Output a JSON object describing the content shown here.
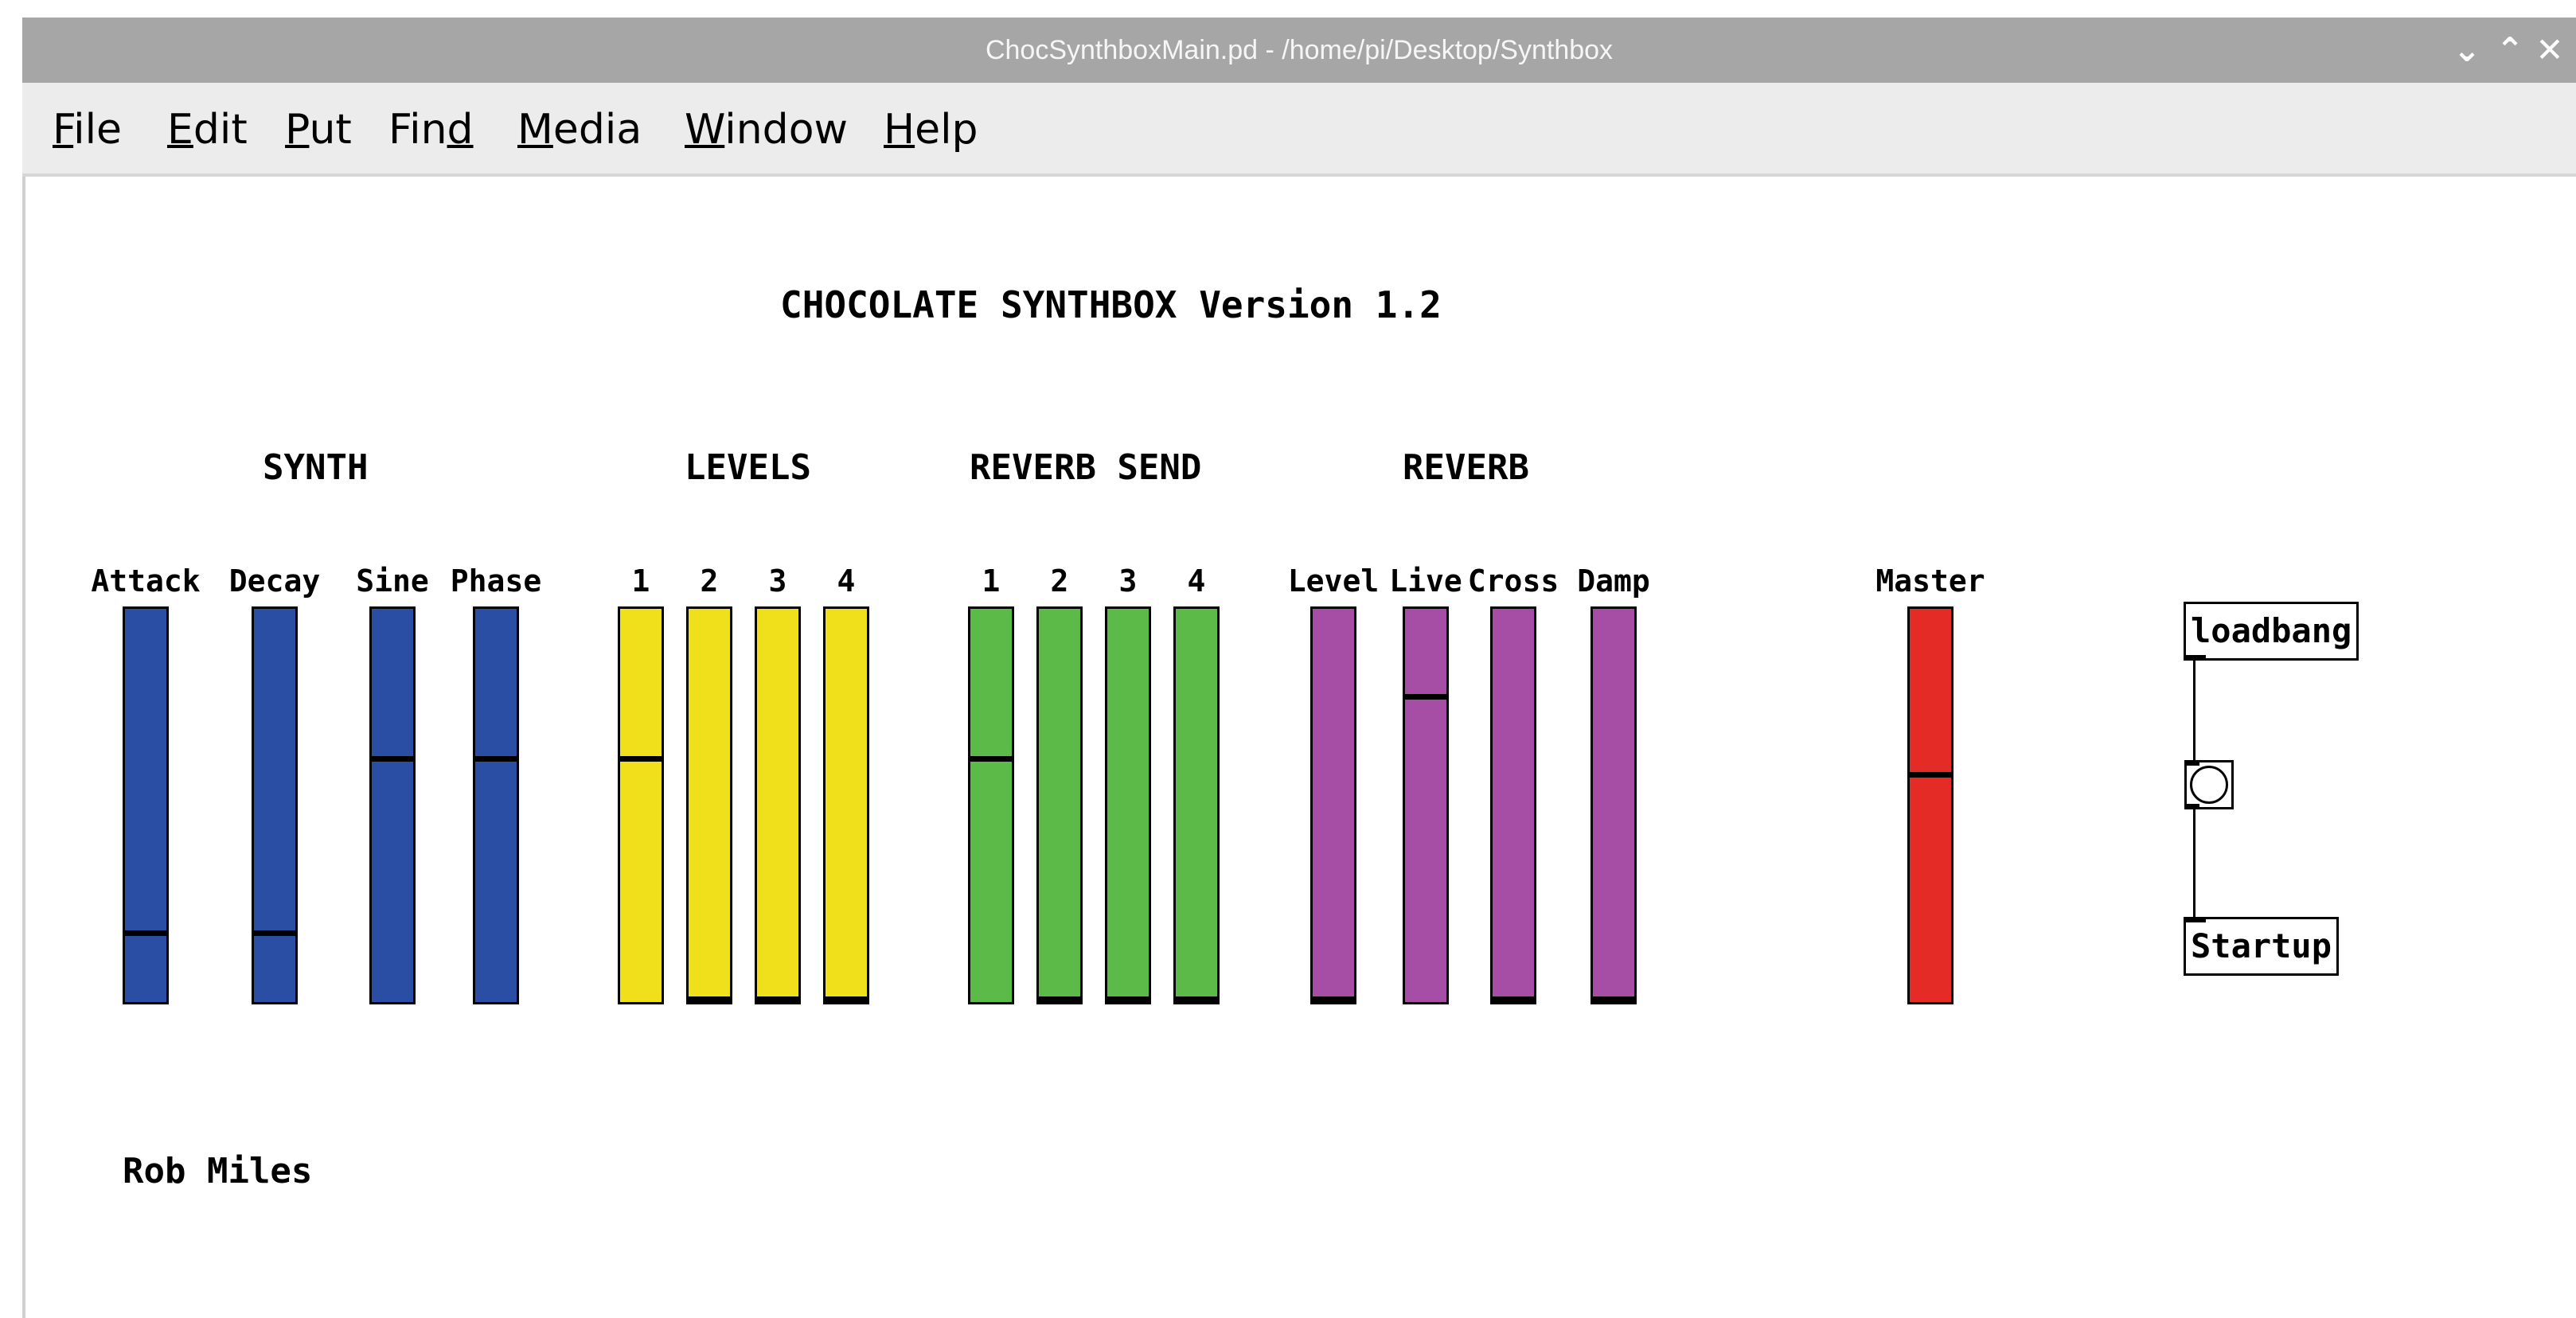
{
  "window": {
    "title": "ChocSynthboxMain.pd  - /home/pi/Desktop/Synthbox",
    "controls": {
      "minimize": "⌄",
      "maximize": "⌃",
      "close": "✕"
    }
  },
  "menu": [
    {
      "pre": "",
      "ul": "F",
      "post": "ile"
    },
    {
      "pre": "",
      "ul": "E",
      "post": "dit"
    },
    {
      "pre": "",
      "ul": "P",
      "post": "ut"
    },
    {
      "pre": "Fin",
      "ul": "d",
      "post": ""
    },
    {
      "pre": "",
      "ul": "M",
      "post": "edia"
    },
    {
      "pre": "",
      "ul": "W",
      "post": "indow"
    },
    {
      "pre": "",
      "ul": "H",
      "post": "elp"
    }
  ],
  "patch": {
    "title": "CHOCOLATE SYNTHBOX Version 1.2",
    "author": "Rob Miles",
    "sections": [
      "SYNTH",
      "LEVELS",
      "REVERB SEND",
      "REVERB"
    ],
    "colors": {
      "synth": "#2b4ea5",
      "levels": "#f0e01c",
      "send": "#5cba48",
      "reverb": "#a64ea5",
      "master": "#e52b26"
    },
    "sliders": [
      {
        "label": "Attack",
        "group": "synth",
        "level": 0.17
      },
      {
        "label": "Decay",
        "group": "synth",
        "level": 0.17
      },
      {
        "label": "Sine",
        "group": "synth",
        "level": 0.62
      },
      {
        "label": "Phase",
        "group": "synth",
        "level": 0.62
      },
      {
        "label": "1",
        "group": "levels",
        "level": 0.62
      },
      {
        "label": "2",
        "group": "levels",
        "level": 0.0
      },
      {
        "label": "3",
        "group": "levels",
        "level": 0.0
      },
      {
        "label": "4",
        "group": "levels",
        "level": 0.0
      },
      {
        "label": "1",
        "group": "send",
        "level": 0.62
      },
      {
        "label": "2",
        "group": "send",
        "level": 0.0
      },
      {
        "label": "3",
        "group": "send",
        "level": 0.0
      },
      {
        "label": "4",
        "group": "send",
        "level": 0.0
      },
      {
        "label": "Level",
        "group": "reverb",
        "level": 0.0
      },
      {
        "label": "Live",
        "group": "reverb",
        "level": 0.78
      },
      {
        "label": "Cross",
        "group": "reverb",
        "level": 0.0
      },
      {
        "label": "Damp",
        "group": "reverb",
        "level": 0.0
      },
      {
        "label": "Master",
        "group": "master",
        "level": 0.58
      }
    ],
    "objects": {
      "loadbang": "loadbang",
      "startup": "Startup"
    }
  }
}
